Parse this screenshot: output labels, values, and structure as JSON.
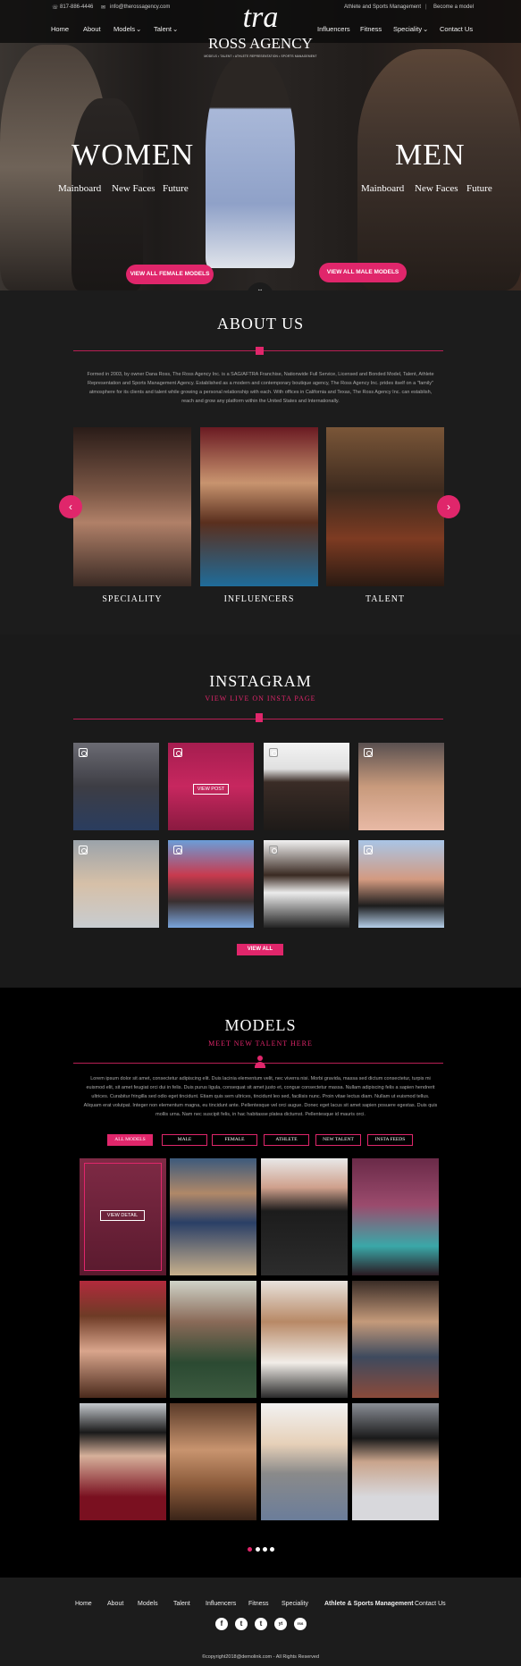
{
  "topbar": {
    "phone": "817-886-4446",
    "email": "info@therossagency.com",
    "link_athlete": "Athlete and Sports Management",
    "link_become": "Become a model",
    "nav_left": [
      "Home",
      "About",
      "Models",
      "Talent"
    ],
    "nav_right": [
      "Influencers",
      "Fitness",
      "Speciality",
      "Contact Us"
    ],
    "logo_mark": "tra",
    "logo_name": "ROSS AGENCY",
    "logo_tagline": "MODELS • TALENT • ATHLETE REPRESENTATION • SPORTS MANAGEMENT"
  },
  "hero": {
    "women_title": "WOMEN",
    "men_title": "MEN",
    "women_links": [
      "Mainboard",
      "New Faces",
      "Future"
    ],
    "men_links": [
      "Mainboard",
      "New Faces",
      "Future"
    ],
    "female_button": "VIEW ALL FEMALE MODELS",
    "male_button": "VIEW ALL MALE MODELS"
  },
  "about": {
    "title": "ABOUT US",
    "text_1": "Formed in 2003, by owner Dana Ross, The Ross Agency Inc. is a SAG/AFTRA Franchise, Nationwide Full Service, Licensed and Bonded Model, Talent, Athlete",
    "text_2": "Representation and Sports Management Agency. Established as a modern and contemporary boutique agency, The Ross Agency Inc. prides itself on a \"family\"",
    "text_3": "atmosphere for its clients and talent while growing a personal relationship with each. With offices in California and Texas, The Ross Agency Inc. can establish,",
    "text_4": "reach and grow any platform within the United States and Internationally.",
    "cards": [
      "SPECIALITY",
      "INFLUENCERS",
      "TALENT"
    ]
  },
  "instagram": {
    "title": "INSTAGRAM",
    "subtitle": "VIEW LIVE ON INSTA PAGE",
    "view_post": "VIEW POST",
    "view_all": "VIEW ALL"
  },
  "models": {
    "title": "MODELS",
    "subtitle": "MEET NEW TALENT HERE",
    "text_1": "Lorem ipsum dolor sit amet, consectetur adipiscing elit. Duis lacinia elementum velit, nec viverra nisi. Morbi gravida, massa sed dictum consectetur, turpis mi",
    "text_2": "euismod elit, sit amet feugiat orci dui in felis. Duis purus ligula, consequat sit amet justo et, congue consectetur massa. Nullam adipiscing felis a sapien hendrerit",
    "text_3": "ultrices. Curabitur fringilla sed odio eget tincidunt. Etiam quis sem ultrices, tincidunt leo sed, facilisis nunc. Proin vitae lectus diam. Nullam ut euismod tellus.",
    "text_4": "Aliquam erat volutpat. Integer non elementum magna, eu tincidunt ante. Pellentesque vel orci augue. Donec eget lacus sit amet sapien posuere egestas. Duis quis",
    "text_5": "mollis urna. Nam nec suscipit felis, in hac habitasse platea dictumst. Pellentesque id mauris orci.",
    "filters": [
      "ALL MODELS",
      "MALE",
      "FEMALE",
      "ATHLETE",
      "NEW TALENT",
      "INSTA FEEDS"
    ],
    "view_detail": "VIEW DETAIL"
  },
  "footer": {
    "nav": [
      "Home",
      "About",
      "Models",
      "Talent",
      "Influencers",
      "Fitness",
      "Speciality",
      "Athlete & Sports Management",
      "Contact Us"
    ],
    "social": [
      "f",
      "t",
      "t",
      "yt",
      "rss"
    ],
    "copyright": "©copyright2018@demolink.com - All Rights Reserved"
  },
  "colors": {
    "accent": "#e0266b",
    "background": "#1c1c1c",
    "dark": "#000000"
  }
}
